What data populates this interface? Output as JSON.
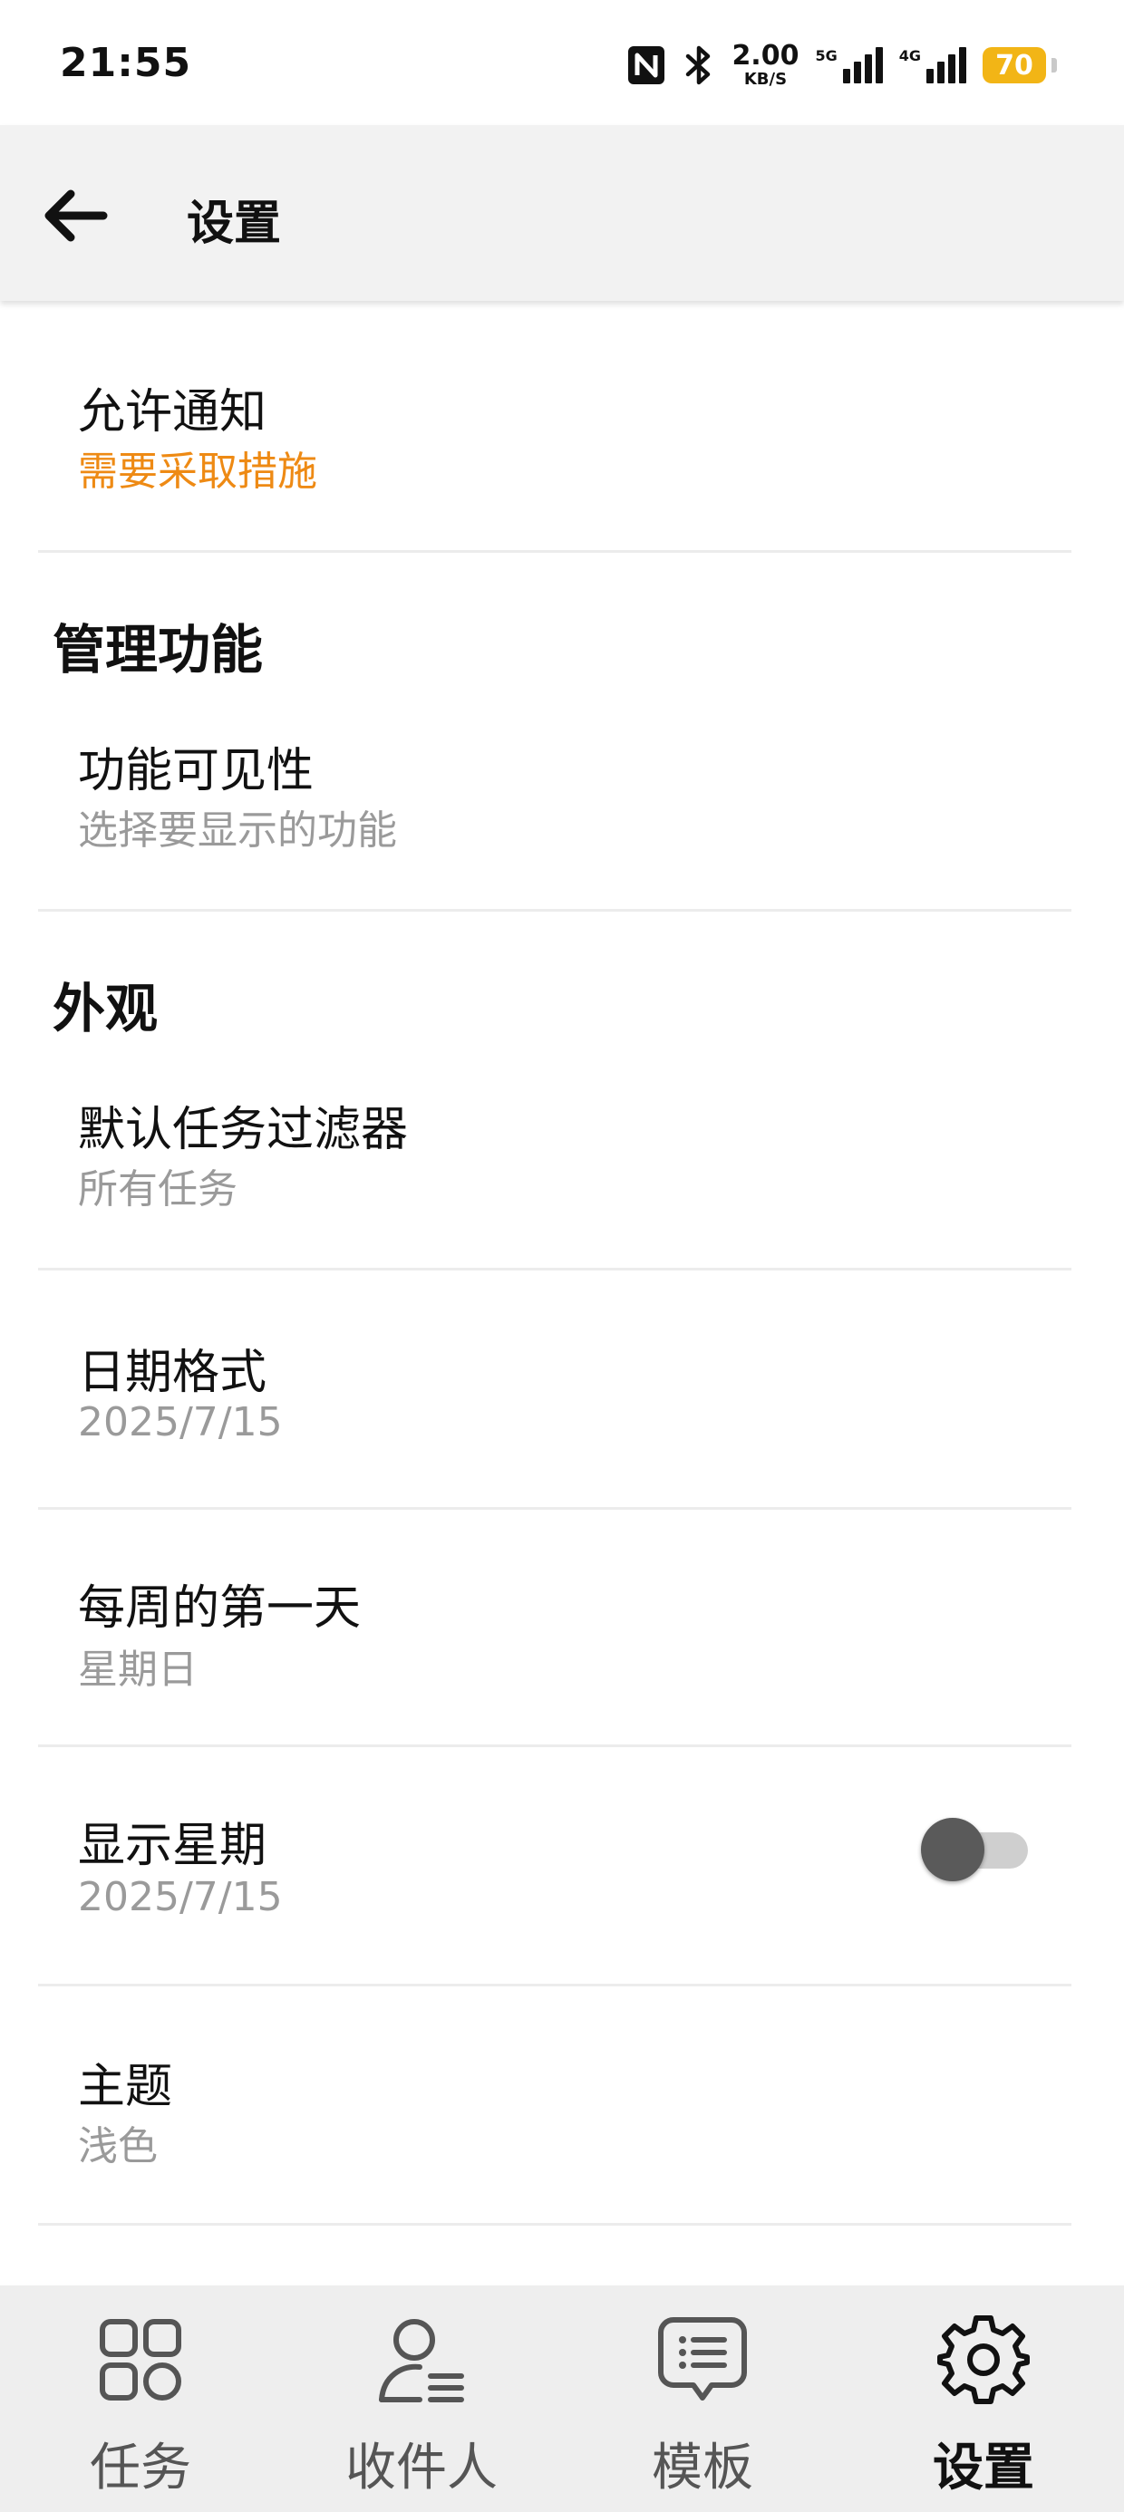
{
  "status_bar": {
    "time": "21:55",
    "net_speed_value": "2.00",
    "net_speed_unit": "KB/S",
    "sim1_label": "5G",
    "sim2_label": "4G",
    "battery_level": "70",
    "battery_color": "#f2b516"
  },
  "app_bar": {
    "title": "设置",
    "back_icon": "arrow-left-icon"
  },
  "settings": {
    "notifications": {
      "title": "允许通知",
      "subtitle": "需要采取措施",
      "subtitle_color": "#ee8a14"
    },
    "section_manage": "管理功能",
    "feature_visibility": {
      "title": "功能可见性",
      "subtitle": "选择要显示的功能"
    },
    "section_appearance": "外观",
    "default_filter": {
      "title": "默认任务过滤器",
      "subtitle": "所有任务"
    },
    "date_format": {
      "title": "日期格式",
      "subtitle": "2025/7/15"
    },
    "first_day": {
      "title": "每周的第一天",
      "subtitle": "星期日"
    },
    "show_weekday": {
      "title": "显示星期",
      "subtitle": "2025/7/15",
      "enabled": false
    },
    "theme": {
      "title": "主题",
      "subtitle": "浅色"
    }
  },
  "bottom_nav": {
    "items": [
      {
        "label": "任务",
        "icon": "grid-icon",
        "active": false
      },
      {
        "label": "收件人",
        "icon": "contacts-icon",
        "active": false
      },
      {
        "label": "模板",
        "icon": "message-list-icon",
        "active": false
      },
      {
        "label": "设置",
        "icon": "gear-icon",
        "active": true
      }
    ]
  }
}
